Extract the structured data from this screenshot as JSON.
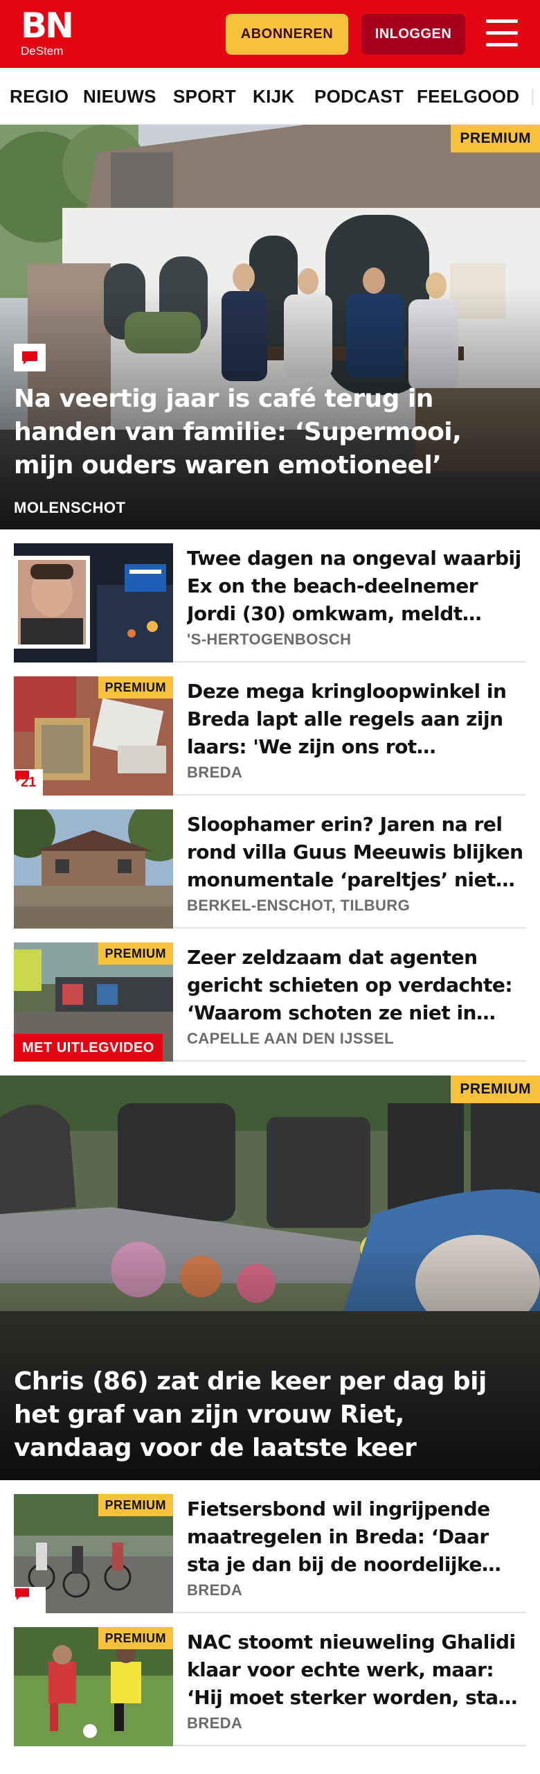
{
  "header": {
    "logo_main": "BN",
    "logo_sub": "DeStem",
    "subscribe_label": "ABONNEREN",
    "login_label": "INLOGGEN"
  },
  "nav": {
    "items": [
      "REGIO",
      "NIEUWS",
      "SPORT",
      "KIJK",
      "PODCAST",
      "FEELGOOD"
    ]
  },
  "hero1": {
    "badge": "PREMIUM",
    "title": "Na veertig jaar is café terug in handen van familie: ‘Supermooi, mijn ouders waren emotioneel’",
    "place": "MOLENSCHOT",
    "has_comments": true
  },
  "articles": [
    {
      "title": "Twee dagen na ongeval waarbij Ex on the beach-deelnemer Jordi (30) omkwam, meldt bestuurder zich",
      "place": "'S-HERTOGENBOSCH"
    },
    {
      "badge": "PREMIUM",
      "comment_count": "21",
      "title": "Deze mega kringloopwinkel in Breda lapt alle regels aan zijn laars: 'We zijn ons rot geschrokken'",
      "place": "BREDA"
    },
    {
      "title": "Sloophamer erin? Jaren na rel rond villa Guus Meeuwis blijken monumentale ‘pareltjes’ niet beschermd",
      "place": "BERKEL-ENSCHOT, TILBURG"
    },
    {
      "badge": "PREMIUM",
      "video_label": "MET UITLEGVIDEO",
      "title": "Zeer zeldzaam dat agenten gericht schieten op verdachte: ‘Waarom schoten ze niet in been?’",
      "place": "CAPELLE AAN DEN IJSSEL"
    }
  ],
  "hero2": {
    "badge": "PREMIUM",
    "title": "Chris (86) zat drie keer per dag bij het graf van zijn vrouw Riet, vandaag voor de laatste keer"
  },
  "articles2": [
    {
      "badge": "PREMIUM",
      "has_comments": true,
      "title": "Fietsersbond wil ingrijpende maatregelen in Breda: ‘Daar sta je dan bij de noordelijke rotonde’",
      "place": "BREDA"
    },
    {
      "badge": "PREMIUM",
      "title": "NAC stoomt nieuweling Ghalidi klaar voor echte werk, maar: ‘Hij moet sterker worden, stap voor stap’",
      "place": "BREDA"
    }
  ],
  "colors": {
    "brand_red": "#e30613",
    "premium_yellow": "#f7c23b",
    "login_dark_red": "#a8001c"
  },
  "icons": [
    "hamburger-menu-icon",
    "comment-bubble-icon"
  ]
}
